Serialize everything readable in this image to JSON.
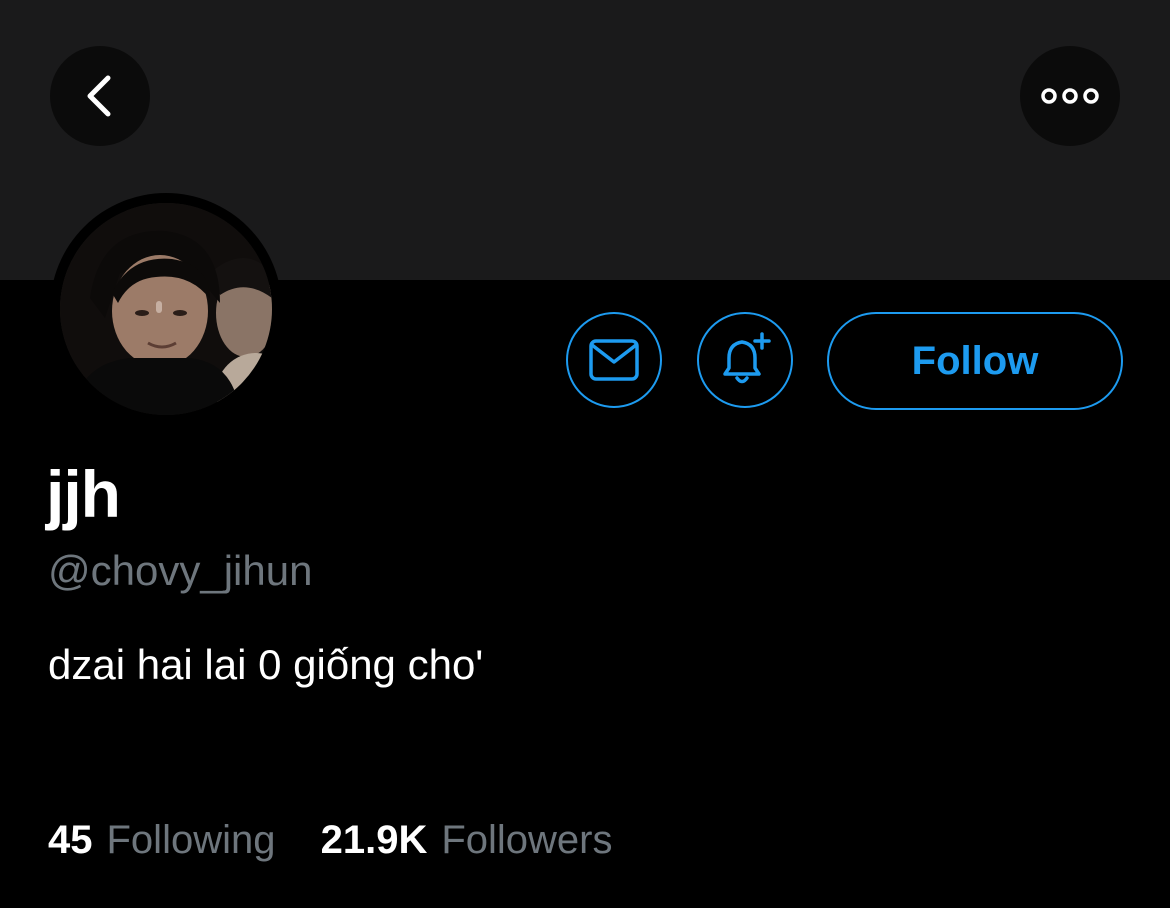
{
  "colors": {
    "background": "#000000",
    "banner": "#1a1a1b",
    "accent": "#1d9bf0",
    "secondary_text": "#6e767d"
  },
  "nav": {
    "back_icon": "chevron-left-icon",
    "more_icon": "more-horizontal-icon"
  },
  "actions": {
    "message_icon": "envelope-icon",
    "notify_icon": "bell-plus-icon",
    "follow_label": "Follow"
  },
  "profile": {
    "display_name": "jjh",
    "handle": "@chovy_jihun",
    "bio": "dzai hai lai 0 giống cho'"
  },
  "stats": {
    "following_count": "45",
    "following_label": "Following",
    "followers_count": "21.9K",
    "followers_label": "Followers"
  }
}
